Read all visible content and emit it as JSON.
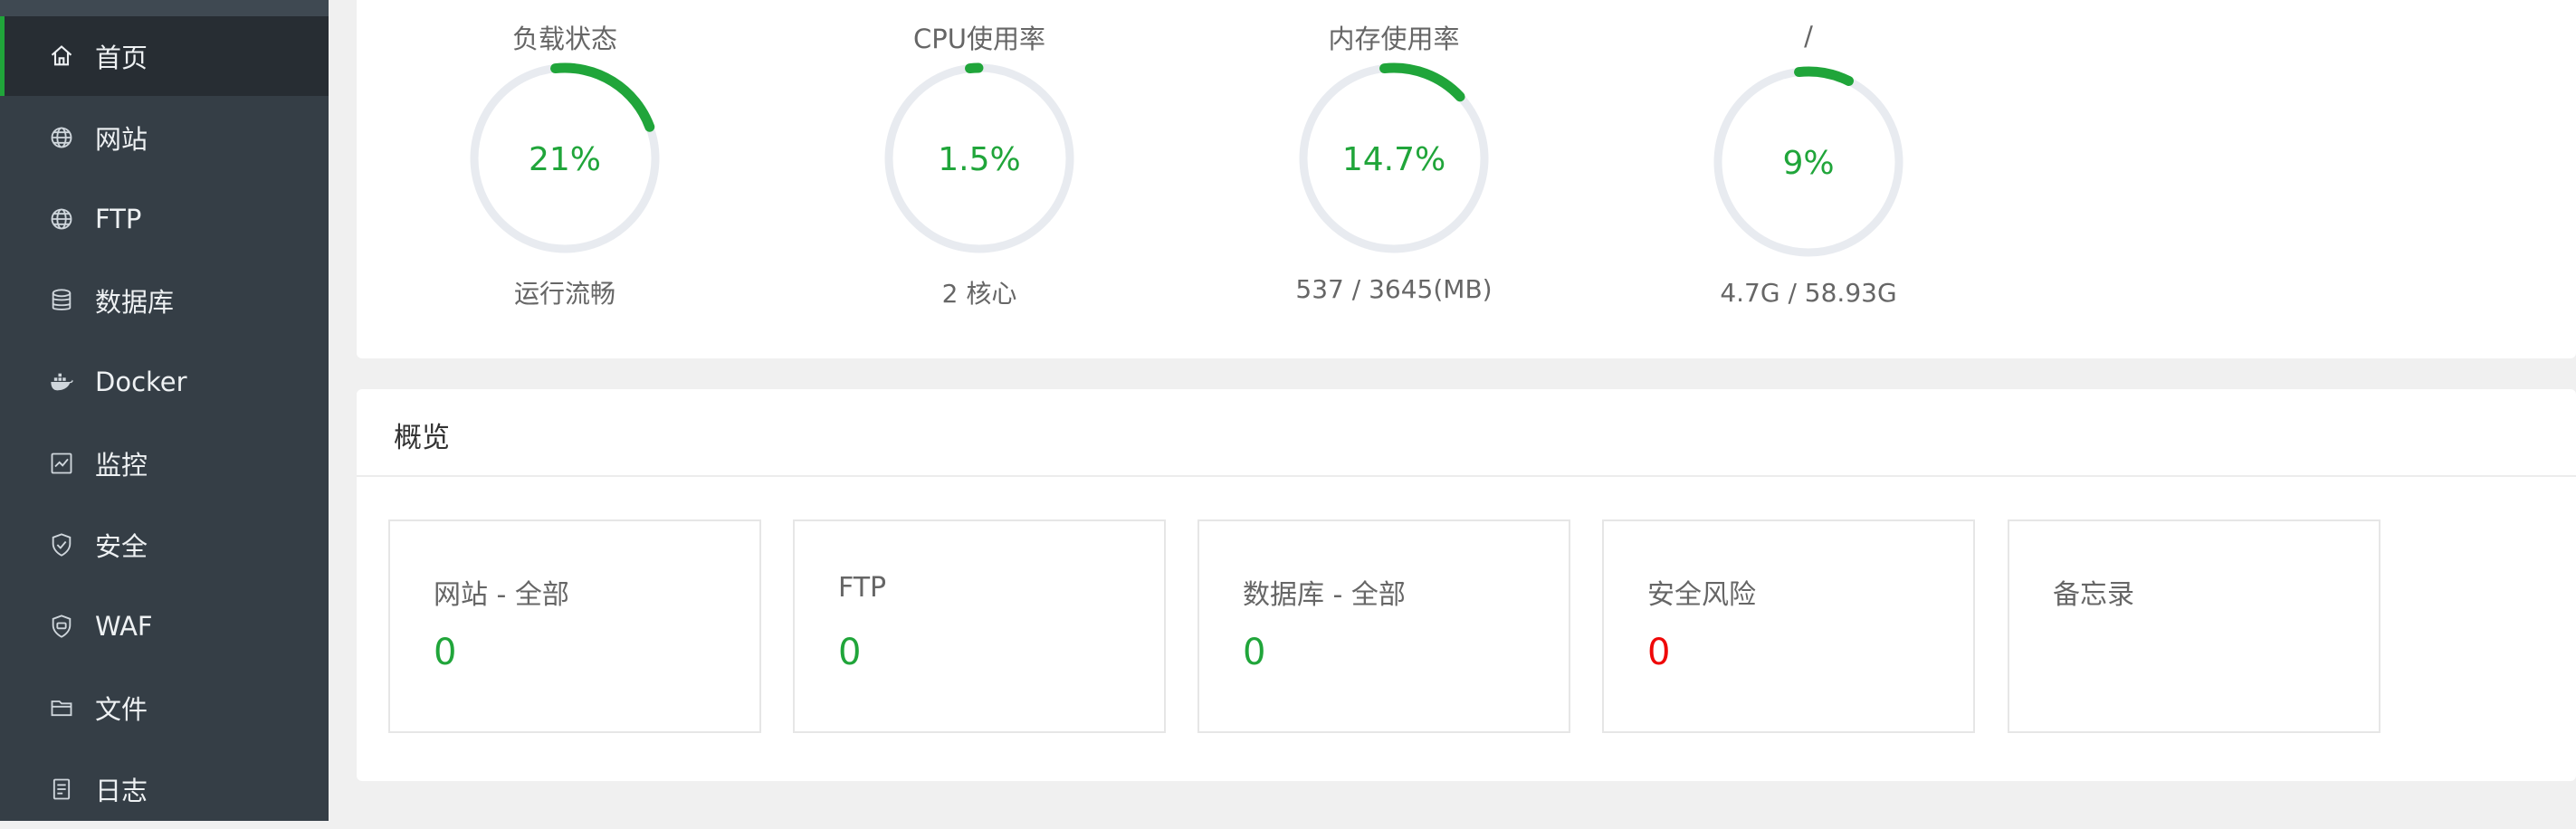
{
  "colors": {
    "accent": "#20a53a",
    "danger": "#ef0808",
    "sidebar_bg": "#353e46",
    "track": "#e8ebf0"
  },
  "sidebar": {
    "items": [
      {
        "label": "首页",
        "icon": "home-icon",
        "active": true
      },
      {
        "label": "网站",
        "icon": "globe-icon"
      },
      {
        "label": "FTP",
        "icon": "ftp-globe-icon"
      },
      {
        "label": "数据库",
        "icon": "database-icon"
      },
      {
        "label": "Docker",
        "icon": "docker-icon"
      },
      {
        "label": "监控",
        "icon": "monitor-icon"
      },
      {
        "label": "安全",
        "icon": "shield-icon"
      },
      {
        "label": "WAF",
        "icon": "waf-shield-icon"
      },
      {
        "label": "文件",
        "icon": "folder-icon"
      },
      {
        "label": "日志",
        "icon": "log-icon"
      }
    ]
  },
  "status": {
    "gauges": [
      {
        "title": "负载状态",
        "value": "21%",
        "percent": 21,
        "sub": "运行流畅"
      },
      {
        "title": "CPU使用率",
        "value": "1.5%",
        "percent": 1.5,
        "sub": "2 核心"
      },
      {
        "title": "内存使用率",
        "value": "14.7%",
        "percent": 14.7,
        "sub": "537 / 3645(MB)"
      },
      {
        "title": "/",
        "value": "9%",
        "percent": 9,
        "sub": "4.7G / 58.93G"
      }
    ]
  },
  "overview": {
    "title": "概览",
    "boxes": [
      {
        "label": "网站 - 全部",
        "value": "0"
      },
      {
        "label": "FTP",
        "value": "0"
      },
      {
        "label": "数据库 - 全部",
        "value": "0"
      },
      {
        "label": "安全风险",
        "value": "0"
      },
      {
        "label": "备忘录",
        "value": ""
      }
    ]
  }
}
